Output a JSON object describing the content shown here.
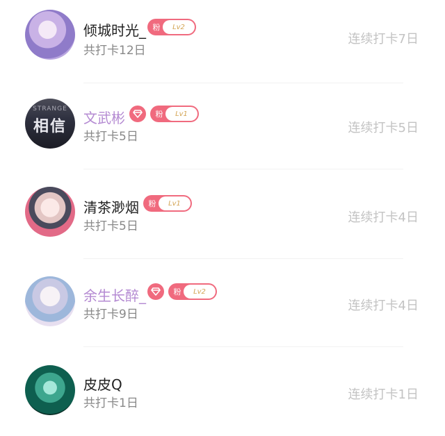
{
  "colors": {
    "accent": "#f06a7e",
    "name_vip": "#b48ad2",
    "name_default": "#222222",
    "subtext": "#888888",
    "streak": "#c3c3c3",
    "level_text": "#d3a454"
  },
  "users": [
    {
      "name": "倾城时光_",
      "name_color": "default",
      "vip": false,
      "fan_label": "粉",
      "level": "Lv2",
      "checkin_total": "共打卡12日",
      "streak": "连续打卡7日",
      "avatar_text": ""
    },
    {
      "name": "文武彬",
      "name_color": "purple",
      "vip": true,
      "fan_label": "粉",
      "level": "Lv1",
      "checkin_total": "共打卡5日",
      "streak": "连续打卡5日",
      "avatar_text": "相信",
      "avatar_small_text": "STRANGE"
    },
    {
      "name": "清茶渺烟",
      "name_color": "default",
      "vip": false,
      "fan_label": "粉",
      "level": "Lv1",
      "checkin_total": "共打卡5日",
      "streak": "连续打卡4日",
      "avatar_text": ""
    },
    {
      "name": "余生长醉_",
      "name_color": "purple",
      "vip": true,
      "fan_label": "粉",
      "level": "Lv2",
      "checkin_total": "共打卡9日",
      "streak": "连续打卡4日",
      "avatar_text": ""
    },
    {
      "name": "皮皮Q",
      "name_color": "default",
      "vip": false,
      "fan_label": "",
      "level": "",
      "checkin_total": "共打卡1日",
      "streak": "连续打卡1日",
      "avatar_text": ""
    }
  ]
}
